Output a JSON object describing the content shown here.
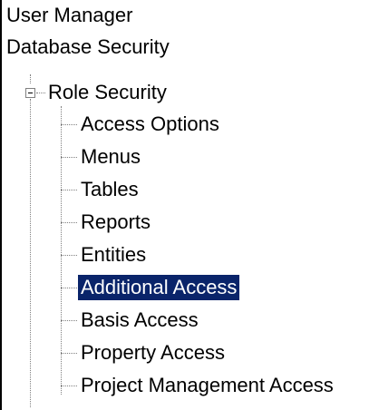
{
  "tree": {
    "roots": [
      {
        "label": "User Manager"
      },
      {
        "label": "Database Security"
      },
      {
        "label": "Role Security",
        "expanded": true,
        "children": [
          {
            "label": "Access Options"
          },
          {
            "label": "Menus"
          },
          {
            "label": "Tables"
          },
          {
            "label": "Reports"
          },
          {
            "label": "Entities"
          },
          {
            "label": "Additional Access",
            "selected": true
          },
          {
            "label": "Basis Access"
          },
          {
            "label": "Property Access"
          },
          {
            "label": "Project Management Access"
          }
        ]
      }
    ]
  },
  "colors": {
    "selection_bg": "#0a246a",
    "selection_text": "#ffffff",
    "connector": "#808080"
  }
}
